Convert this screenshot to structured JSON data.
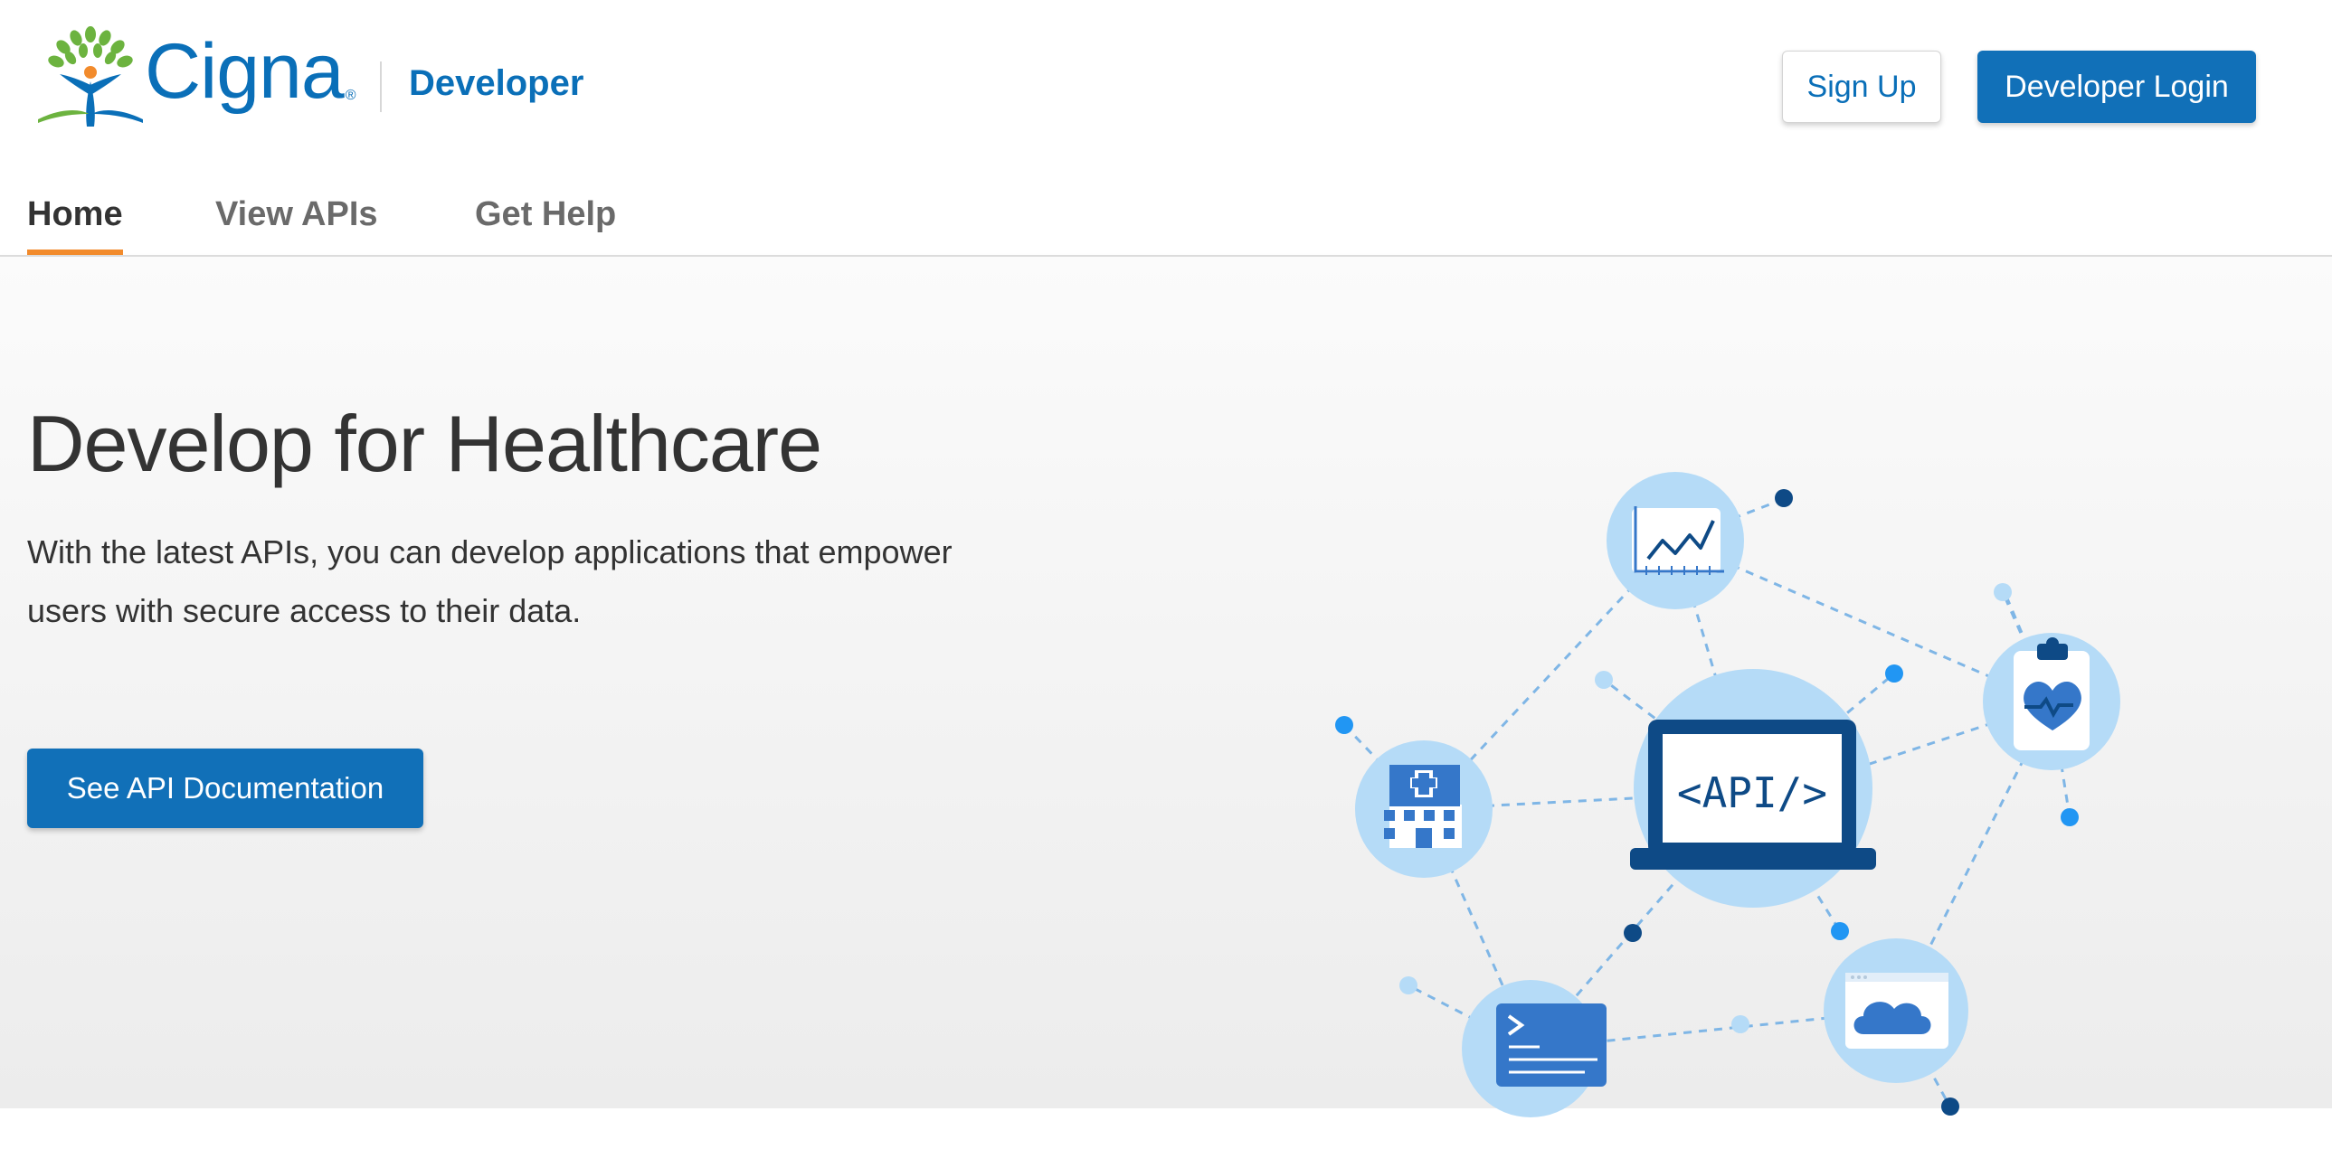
{
  "brand": {
    "name": "Cigna",
    "registered_mark": "®",
    "portal_label": "Developer",
    "colors": {
      "blue": "#0a6fb8",
      "leaf_green": "#6cb33f",
      "leaf_orange": "#f28b2c",
      "accent_orange": "#f28b2c"
    }
  },
  "header": {
    "signup_label": "Sign Up",
    "login_label": "Developer Login"
  },
  "nav": {
    "tabs": [
      {
        "label": "Home",
        "active": true
      },
      {
        "label": "View APIs",
        "active": false
      },
      {
        "label": "Get Help",
        "active": false
      }
    ]
  },
  "hero": {
    "title": "Develop for Healthcare",
    "text": "With the latest APIs, you can develop applications that empower users with secure access to their data.",
    "cta_label": "See API Documentation",
    "illustration": {
      "center_label": "<API/>",
      "icons": [
        "analytics-chart-icon",
        "health-clipboard-icon",
        "hospital-icon",
        "terminal-icon",
        "cloud-icon",
        "laptop-api-icon"
      ]
    }
  }
}
